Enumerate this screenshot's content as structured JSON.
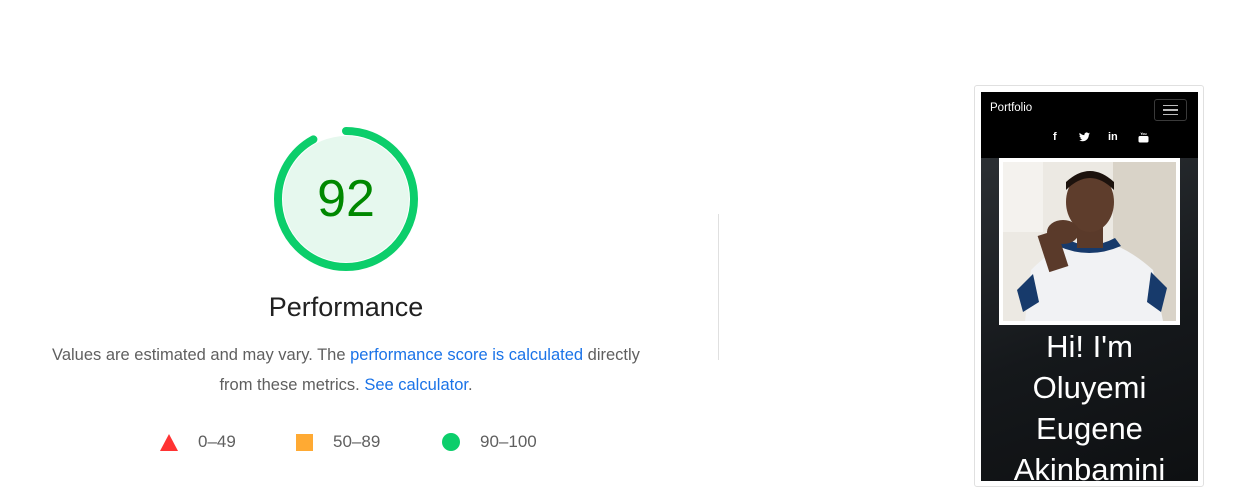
{
  "performance": {
    "score": "92",
    "score_fraction": 0.92,
    "title": "Performance",
    "desc_part1": "Values are estimated and may vary. The ",
    "desc_link1": "performance score is calculated",
    "desc_part2": " directly from these metrics. ",
    "desc_link2": "See calculator",
    "desc_end": ".",
    "gauge_color": "#0cce6b",
    "gauge_bg": "#e6f8ee",
    "score_color": "#008800"
  },
  "legend": {
    "fail": {
      "label": "0–49",
      "color": "#ff3333",
      "icon": "triangle-icon"
    },
    "average": {
      "label": "50–89",
      "color": "#ffaa33",
      "icon": "square-icon"
    },
    "pass": {
      "label": "90–100",
      "color": "#0cce6b",
      "icon": "circle-icon"
    }
  },
  "screenshot": {
    "brand": "Portfolio",
    "menu_icon": "hamburger-icon",
    "social_icons": {
      "facebook": "f",
      "twitter": "🐦",
      "linkedin": "in",
      "youtube": "▶"
    },
    "hero_lines": [
      "Hi! I'm",
      "Oluyemi",
      "Eugene",
      "Akinbamini"
    ]
  }
}
